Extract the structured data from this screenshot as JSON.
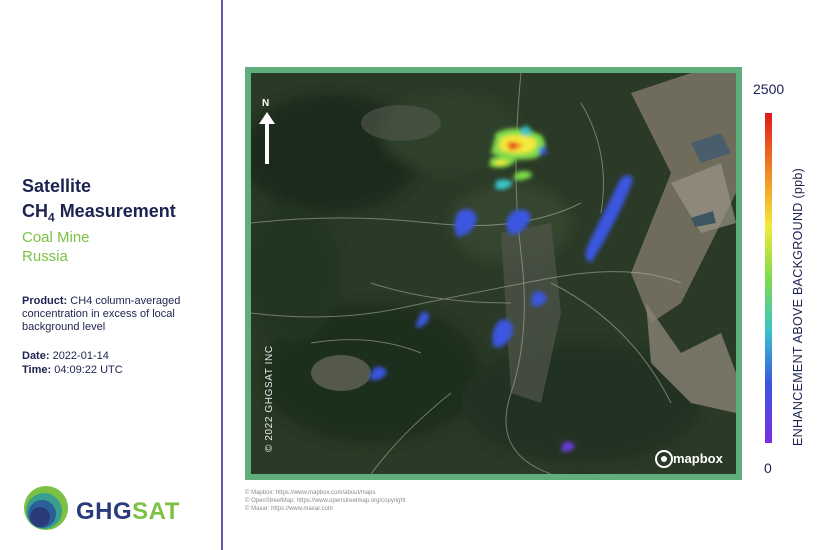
{
  "sidebar": {
    "title_line1": "Satellite",
    "title_line2_main": "CH",
    "title_line2_sub": "4",
    "title_line2_rest": " Measurement",
    "location_line1": "Coal Mine",
    "location_line2": "Russia",
    "product_label": "Product:",
    "product_text": " CH4 column-averaged concentration in excess of local background level",
    "date_label": "Date:",
    "date_value": " 2022-01-14",
    "time_label": "Time:",
    "time_value": " 04:09:22 UTC",
    "logo_text_part1": "GHG",
    "logo_text_part2": "SAT"
  },
  "map": {
    "north_label": "N",
    "copyright": "© 2022 GHGSAT INC",
    "mapbox_label": "mapbox",
    "attribution_lines": [
      "© Mapbox: https://www.mapbox.com/about/maps",
      "© OpenStreetMap: https://www.openstreetmap.org/copyright",
      "© Maxar: https://www.maxar.com"
    ]
  },
  "colorbar": {
    "max_label": "2500",
    "min_label": "0",
    "axis_label": "ENHANCEMENT ABOVE BACKGROUND (ppb)",
    "colors": [
      "#e0191b",
      "#f08a24",
      "#f4e93a",
      "#7fdc4b",
      "#39c3c9",
      "#3b57e0",
      "#7a2ee0"
    ]
  }
}
